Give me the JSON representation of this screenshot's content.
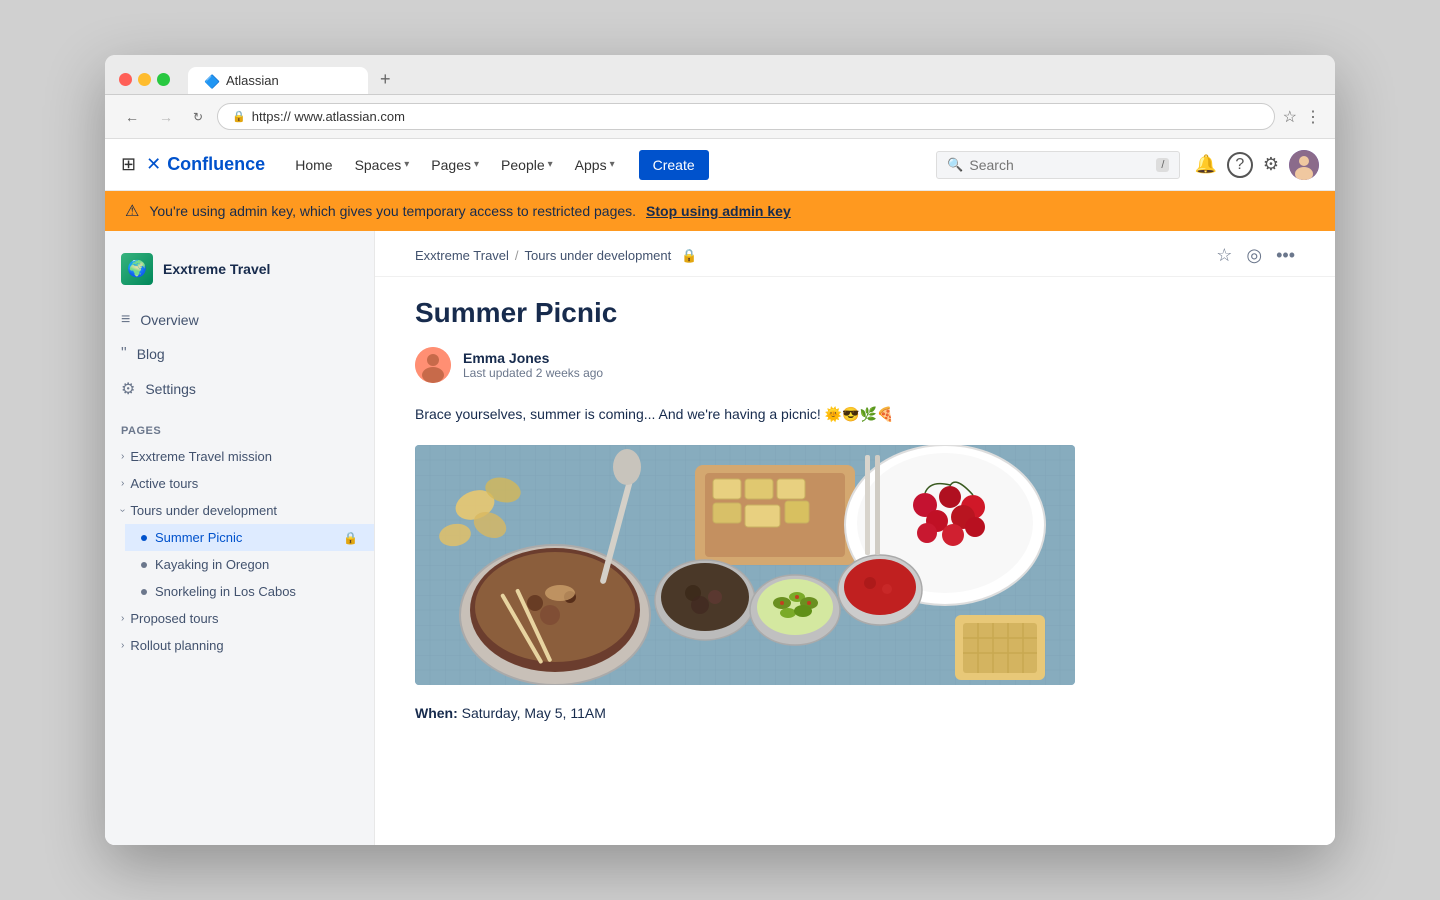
{
  "browser": {
    "tab_label": "Atlassian",
    "url": "https:// www.atlassian.com",
    "tab_add": "+",
    "back_btn": "←",
    "forward_btn": "→",
    "refresh_btn": "↻",
    "star_icon": "☆",
    "more_icon": "⋮"
  },
  "nav": {
    "home": "Home",
    "spaces": "Spaces",
    "pages": "Pages",
    "people": "People",
    "apps": "Apps",
    "create": "Create",
    "search_placeholder": "Search",
    "logo_text": "Confluence"
  },
  "banner": {
    "message": "You're using admin key, which gives you temporary access to restricted pages.",
    "link_text": "Stop using admin key"
  },
  "sidebar": {
    "space_name": "Exxtreme Travel",
    "overview_label": "Overview",
    "blog_label": "Blog",
    "settings_label": "Settings",
    "pages_section": "PAGES",
    "pages": [
      {
        "label": "Exxtreme Travel mission",
        "level": 0,
        "type": "chevron",
        "expanded": false
      },
      {
        "label": "Active tours",
        "level": 0,
        "type": "chevron",
        "expanded": false
      },
      {
        "label": "Tours under development",
        "level": 0,
        "type": "chevron",
        "expanded": true
      },
      {
        "label": "Summer Picnic",
        "level": 1,
        "type": "bullet",
        "active": true,
        "locked": true
      },
      {
        "label": "Kayaking in Oregon",
        "level": 1,
        "type": "bullet"
      },
      {
        "label": "Snorkeling in Los Cabos",
        "level": 1,
        "type": "bullet"
      },
      {
        "label": "Proposed tours",
        "level": 0,
        "type": "chevron",
        "expanded": false
      },
      {
        "label": "Rollout planning",
        "level": 0,
        "type": "chevron",
        "expanded": false
      }
    ]
  },
  "breadcrumb": {
    "parts": [
      "Exxtreme Travel",
      "Tours under development"
    ],
    "separator": "/"
  },
  "page": {
    "title": "Summer Picnic",
    "author_name": "Emma Jones",
    "author_date": "Last updated 2 weeks ago",
    "body_text": "Brace yourselves, summer is coming... And we're having a picnic! 🌞😎🌿🍕",
    "when_label": "When:",
    "when_value": "Saturday, May 5, 11AM"
  },
  "icons": {
    "grid": "⊞",
    "confluence": "✕",
    "chevron_down": "▾",
    "star": "☆",
    "watch": "◎",
    "more": "…",
    "search": "🔍",
    "bell": "🔔",
    "help": "?",
    "settings": "⚙",
    "lock": "🔒",
    "warning": "⚠",
    "chevron_right": "›",
    "chevron_down_small": "∨"
  },
  "colors": {
    "accent_blue": "#0052cc",
    "text_dark": "#172b4d",
    "text_mid": "#42526e",
    "text_light": "#6b778c",
    "banner_orange": "#ff991f",
    "lock_red": "#de350b",
    "active_bg": "#deebff"
  }
}
